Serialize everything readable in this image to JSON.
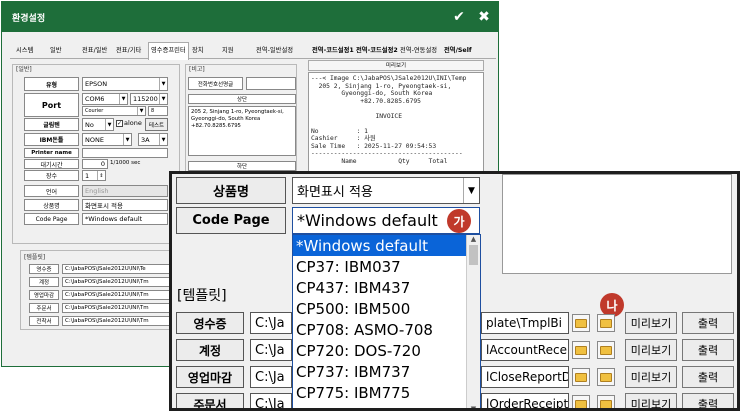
{
  "window": {
    "title": "환경설정",
    "ok_icon": "check-icon",
    "close_icon": "close-icon"
  },
  "tabs": [
    "시스템",
    "일반",
    "전표/일반",
    "전표/기타",
    "영수증프린터",
    "장치",
    "지원",
    "전역-일반설정",
    "전역-코드설정1",
    "전역-코드설정2",
    "전역-연동설정",
    "전역/Self"
  ],
  "general": {
    "group": "[일반]",
    "type_label": "유형",
    "type_value": "EPSON",
    "port_label": "Port",
    "port_value": "COM6",
    "baud_value": "115200",
    "font_value": "Courier",
    "font_size": "8",
    "density_label": "글림텐",
    "density_value": "No",
    "alone_label": "alone",
    "test_button": "테스트",
    "ibm_label": "IBM돈틀",
    "ibm_value": "NONE",
    "ibm_mode": "3A",
    "printer_name_label": "Printer name",
    "wait_label": "대기시간",
    "wait_value": "0",
    "wait_unit": "1/1000 sec",
    "copies_label": "장수",
    "copies_value": "1",
    "lang_label": "언어",
    "lang_value": "English",
    "product_label": "상품명",
    "product_value": "화면표시 적용",
    "codepage_label": "Code Page",
    "codepage_value": "*Windows default"
  },
  "remark": {
    "group": "[비고]",
    "phone_label": "전화번호선명글",
    "top_label": "상단",
    "top_text": "205 2, Sinjang 1-ro, Pyeongtaek-si,\nGyeonggi-do, South Korea\n+82.70.8285.6795",
    "bottom_label": "하단"
  },
  "preview": {
    "title": "미리보기",
    "text": "---< Image C:\\JabaPOS\\JSale2012U\\INI\\Temp\n  205 2, Sinjang 1-ro, Pyeongtaek-si,\n        Gyeonggi-do, South Korea\n             +82.70.8285.6795\n\n                 INVOICE\n\nNo          : 1\nCashier     : 사원\nSale Time   : 2025-11-27 09:54:53\n----------------------------------------\n        Name           Qty     Total"
  },
  "templates_small": {
    "group": "[템플릿]",
    "rows": [
      {
        "label": "영수증",
        "path": "C:\\JabaPOS\\JSale2012U\\INI\\Te"
      },
      {
        "label": "계정",
        "path": "C:\\JabaPOS\\JSale2012U\\INI\\Tm"
      },
      {
        "label": "영업마감",
        "path": "C:\\JabaPOS\\JSale2012U\\INI\\Tm"
      },
      {
        "label": "주문서",
        "path": "C:\\JabaPOS\\JSale2012U\\INI\\Tm"
      },
      {
        "label": "전착서",
        "path": "C:\\JabaPOS\\JSale2012U\\INI\\Tm"
      }
    ]
  },
  "zoom": {
    "product_label": "상품명",
    "product_value": "화면표시 적용",
    "codepage_label": "Code Page",
    "codepage_value": "*Windows default",
    "badge_a": "가",
    "badge_b": "나",
    "template_group": "[템플릿]",
    "codepage_options": [
      "*Windows default",
      "CP37: IBM037",
      "CP437: IBM437",
      "CP500: IBM500",
      "CP708: ASMO-708",
      "CP720: DOS-720",
      "CP737: IBM737",
      "CP775: IBM775"
    ],
    "rows": [
      {
        "label": "영수증",
        "path_left": "C:\\Ja",
        "path_right": "plate\\TmplBi",
        "preview": "미리보기",
        "print": "출력"
      },
      {
        "label": "계정",
        "path_left": "C:\\Ja",
        "path_right": "lAccountRecei",
        "preview": "미리보기",
        "print": "출력"
      },
      {
        "label": "영업마감",
        "path_left": "C:\\Ja",
        "path_right": "lCloseReportD",
        "preview": "미리보기",
        "print": "출력"
      },
      {
        "label": "주문서",
        "path_left": "C:\\Ja",
        "path_right": "lOrderReceipt",
        "preview": "미리보기",
        "print": "출력"
      }
    ]
  },
  "colors": {
    "title_bar": "#1e6e3a",
    "selection": "#0a64d8",
    "badge": "#c0392b"
  }
}
